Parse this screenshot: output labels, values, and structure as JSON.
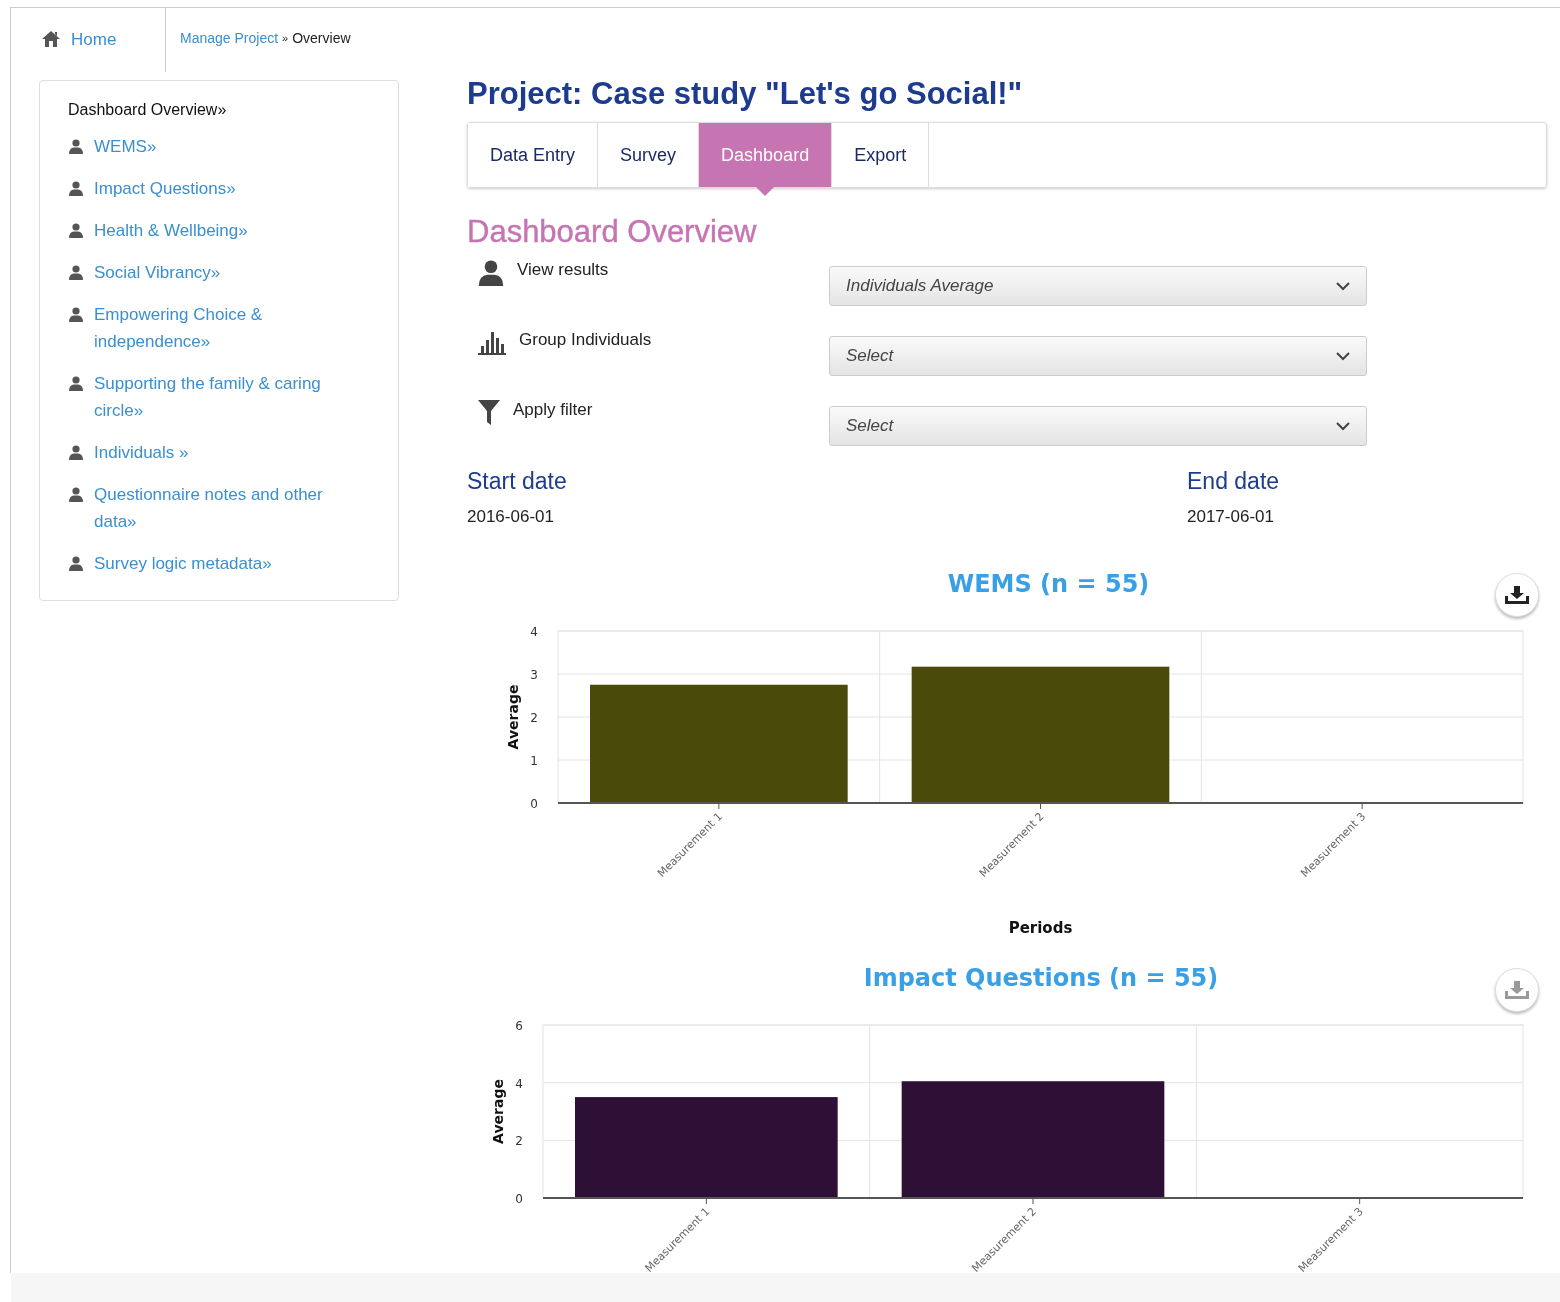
{
  "breadcrumb": {
    "home": "Home",
    "items": [
      {
        "label": "Manage Project",
        "kind": "link"
      },
      {
        "label": "»",
        "kind": "separator"
      },
      {
        "label": "Overview",
        "kind": "current"
      }
    ]
  },
  "sidebar": {
    "heading": "Dashboard Overview»",
    "items": [
      "WEMS»",
      "Impact Questions»",
      "Health & Wellbeing»",
      "Social Vibrancy»",
      "Empowering Choice & independence»",
      "Supporting the family & caring circle»",
      "Individuals »",
      "Questionnaire notes and other data»",
      "Survey logic metadata»"
    ]
  },
  "project_title": "Project: Case study \"Let's go Social!\"",
  "tabs": [
    {
      "label": "Data Entry",
      "selected": false
    },
    {
      "label": "Survey",
      "selected": false
    },
    {
      "label": "Dashboard",
      "selected": true
    },
    {
      "label": "Export",
      "selected": false
    }
  ],
  "section_title": "Dashboard Overview",
  "filters": [
    {
      "kind": "person",
      "label": "View results",
      "value": "Individuals Average"
    },
    {
      "kind": "bars",
      "label": "Group Individuals",
      "value": "Select"
    },
    {
      "kind": "funnel",
      "label": "Apply filter",
      "value": "Select"
    }
  ],
  "dates": [
    {
      "label": "Start date",
      "value": "2016-06-01"
    },
    {
      "label": "End date",
      "value": "2017-06-01"
    }
  ],
  "charts": [
    {
      "download_enabled": true,
      "chart_data": {
        "type": "bar",
        "title": "WEMS (n = 55)",
        "xlabel": "Periods",
        "ylabel": "Average",
        "categories": [
          "Measurement 1",
          "Measurement 2",
          "Measurement 3"
        ],
        "grid": true,
        "series": [
          {
            "color": "#4a4a0a",
            "values": [
              2.75,
              3.17,
              null
            ]
          }
        ],
        "ylim": [
          0,
          4
        ],
        "yticks": [
          0,
          1,
          2,
          3,
          4
        ]
      }
    },
    {
      "download_enabled": false,
      "chart_data": {
        "type": "bar",
        "title": "Impact Questions (n = 55)",
        "ylabel": "Average",
        "categories": [
          "Measurement 1",
          "Measurement 2",
          "Measurement 3"
        ],
        "grid": true,
        "series": [
          {
            "color": "#2e0f35",
            "values": [
              3.5,
              4.05,
              null
            ]
          }
        ],
        "ylim": [
          0,
          6
        ],
        "yticks": [
          0,
          2,
          4,
          6
        ]
      }
    }
  ]
}
